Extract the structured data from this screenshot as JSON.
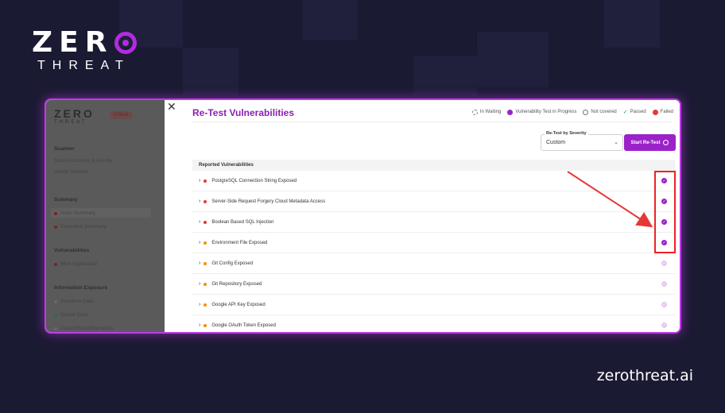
{
  "brand": {
    "logo_top": "ZER",
    "logo_bottom": "THREAT",
    "domain": "zerothreat.ai"
  },
  "sidebar": {
    "logo_top": "ZERO",
    "logo_bottom": "THREAT",
    "severity_badge": "Critical",
    "sections": [
      {
        "title": "Scanner",
        "items": [
          "Scan Discovery & Activity",
          "Attack Surface"
        ]
      },
      {
        "title": "Summary",
        "items": [
          "Scan Summary",
          "Executive Summary"
        ]
      },
      {
        "title": "Vulnerabilities",
        "items": [
          "Web Application"
        ]
      },
      {
        "title": "Information Exposure",
        "items": [
          "Sensitive Data",
          "Secret Data",
          "Cloud Misconfiguration"
        ]
      }
    ]
  },
  "modal": {
    "title": "Re-Test Vulnerabilities",
    "legend": [
      "In Waiting",
      "Vulnerability Test in Progress",
      "Not covered",
      "Passed",
      "Failed"
    ],
    "retest_label": "Re-Test by Severity",
    "retest_value": "Custom",
    "start_button": "Start Re-Test",
    "table_header": "Reported Vulnerabilities",
    "rows": [
      {
        "name": "PostgreSQL Connection String Exposed",
        "severity_color": "#e53935",
        "status": "in-progress"
      },
      {
        "name": "Server-Side Request Forgery Cloud Metadata Access",
        "severity_color": "#e53935",
        "status": "in-progress"
      },
      {
        "name": "Boolean Based SQL Injection",
        "severity_color": "#e53935",
        "status": "in-progress"
      },
      {
        "name": "Environment File Exposed",
        "severity_color": "#fb8c00",
        "status": "in-progress"
      },
      {
        "name": "Git Config Exposed",
        "severity_color": "#fb8c00",
        "status": "pending"
      },
      {
        "name": "Git Repository Exposed",
        "severity_color": "#fb8c00",
        "status": "pending"
      },
      {
        "name": "Google API Key Exposed",
        "severity_color": "#fb8c00",
        "status": "pending"
      },
      {
        "name": "Google OAuth Token Exposed",
        "severity_color": "#fb8c00",
        "status": "pending"
      }
    ]
  },
  "colors": {
    "accent": "#9a22c8",
    "frame": "#c03ce8",
    "background": "#1b1a33",
    "arrow": "#e53935"
  }
}
